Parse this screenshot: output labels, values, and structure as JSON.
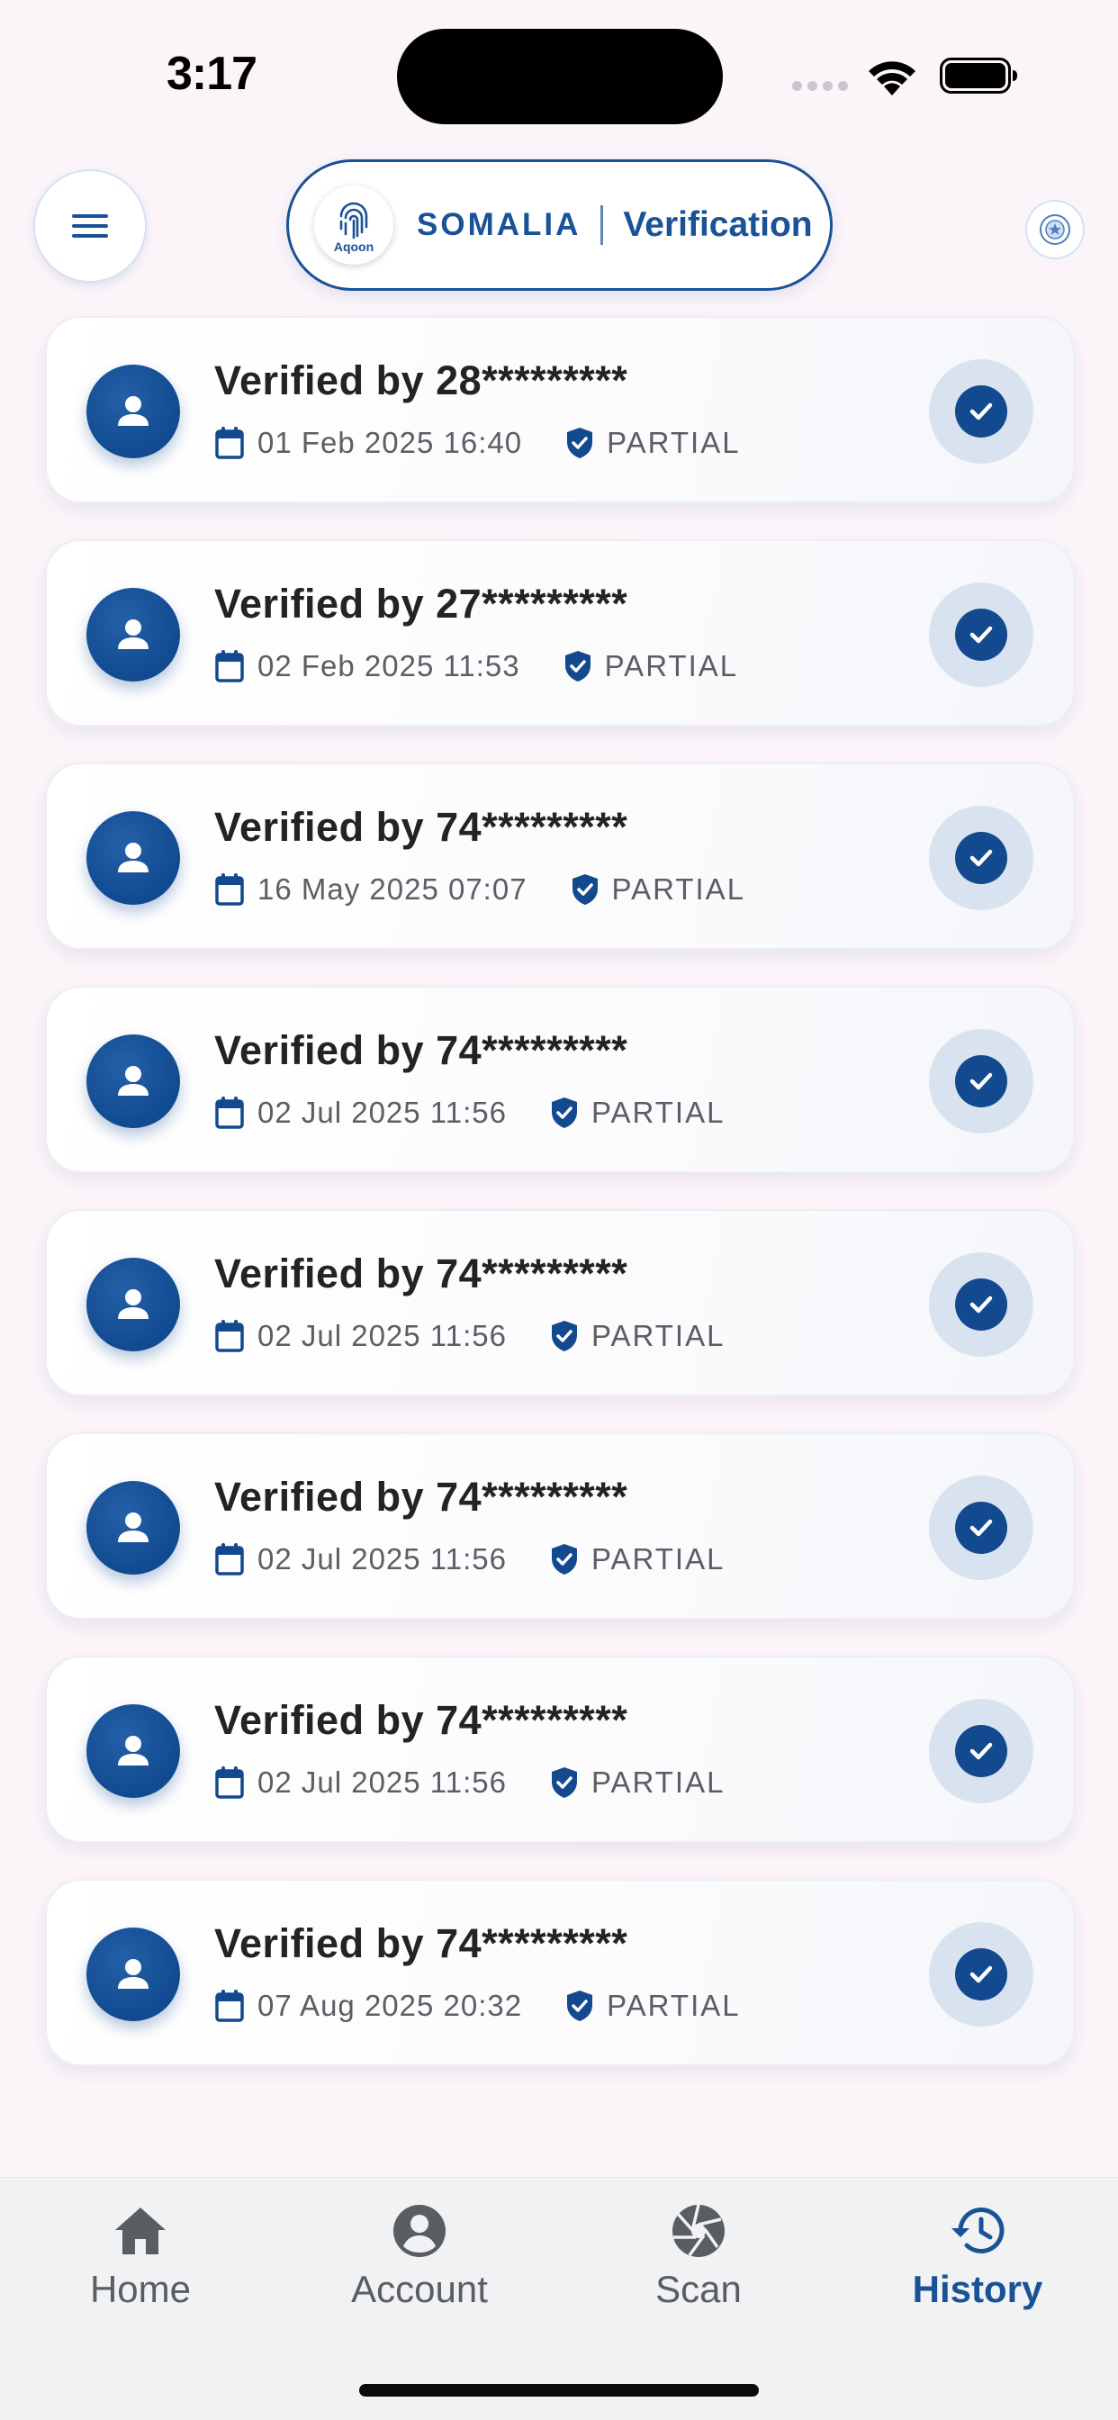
{
  "status_bar": {
    "time": "3:17"
  },
  "header": {
    "brand_logo_text": "Aqoon",
    "brand_country": "SOMALIA",
    "brand_app": "Verification"
  },
  "history": [
    {
      "title": "Verified by 28*********",
      "date": "01 Feb 2025 16:40",
      "level": "PARTIAL"
    },
    {
      "title": "Verified by 27*********",
      "date": "02 Feb 2025 11:53",
      "level": "PARTIAL"
    },
    {
      "title": "Verified by 74*********",
      "date": "16 May 2025 07:07",
      "level": "PARTIAL"
    },
    {
      "title": "Verified by 74*********",
      "date": "02 Jul 2025 11:56",
      "level": "PARTIAL"
    },
    {
      "title": "Verified by 74*********",
      "date": "02 Jul 2025 11:56",
      "level": "PARTIAL"
    },
    {
      "title": "Verified by 74*********",
      "date": "02 Jul 2025 11:56",
      "level": "PARTIAL"
    },
    {
      "title": "Verified by 74*********",
      "date": "02 Jul 2025 11:56",
      "level": "PARTIAL"
    },
    {
      "title": "Verified by 74*********",
      "date": "07 Aug 2025 20:32",
      "level": "PARTIAL"
    }
  ],
  "nav": {
    "items": [
      {
        "label": "Home",
        "icon": "home-icon"
      },
      {
        "label": "Account",
        "icon": "account-icon"
      },
      {
        "label": "Scan",
        "icon": "scan-icon"
      },
      {
        "label": "History",
        "icon": "history-icon"
      }
    ],
    "active": "History"
  },
  "colors": {
    "primary": "#1a5298",
    "background": "#fbf4f9",
    "check_bg": "#d9e3f0",
    "nav_bg": "#f0f2f3"
  }
}
